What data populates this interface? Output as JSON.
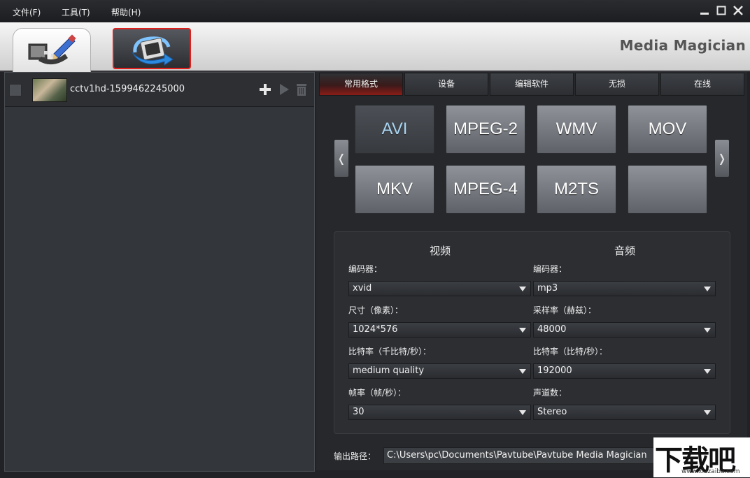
{
  "menubar": {
    "items": [
      {
        "label": "文件(F)"
      },
      {
        "label": "工具(T)"
      },
      {
        "label": "帮助(H)"
      }
    ]
  },
  "header": {
    "brand": "Media Magician",
    "tabs": [
      {
        "name": "edit-tab",
        "icon": "film-edit-icon",
        "active": false
      },
      {
        "name": "convert-tab",
        "icon": "film-convert-icon",
        "active": true
      }
    ]
  },
  "file_list": {
    "items": [
      {
        "name": "cctv1hd-1599462245000",
        "checked": false
      }
    ]
  },
  "format_tabs": [
    {
      "label": "常用格式",
      "active": true
    },
    {
      "label": "设备"
    },
    {
      "label": "编辑软件"
    },
    {
      "label": "无损"
    },
    {
      "label": "在线"
    }
  ],
  "formats": [
    {
      "label": "AVI",
      "selected": true
    },
    {
      "label": "MPEG-2"
    },
    {
      "label": "WMV"
    },
    {
      "label": "MOV"
    },
    {
      "label": "MKV"
    },
    {
      "label": "MPEG-4"
    },
    {
      "label": "M2TS"
    },
    {
      "label": ""
    }
  ],
  "settings": {
    "video": {
      "title": "视频",
      "codec_label": "编码器：",
      "codec": "xvid",
      "size_label": "尺寸（像素）：",
      "size": "1024*576",
      "bitrate_label": "比特率（千比特/秒）：",
      "bitrate": "medium quality",
      "framerate_label": "帧率（帧/秒）：",
      "framerate": "30"
    },
    "audio": {
      "title": "音频",
      "codec_label": "编码器：",
      "codec": "mp3",
      "samplerate_label": "采样率（赫兹）：",
      "samplerate": "48000",
      "bitrate_label": "比特率（比特/秒）：",
      "bitrate": "192000",
      "channels_label": "声道数：",
      "channels": "Stereo"
    }
  },
  "output": {
    "label": "输出路径：",
    "path": "C:\\Users\\pc\\Documents\\Pavtube\\Pavtube Media Magician"
  },
  "watermark": {
    "main": "下载吧",
    "sub": "www.xiazaiba.com"
  }
}
